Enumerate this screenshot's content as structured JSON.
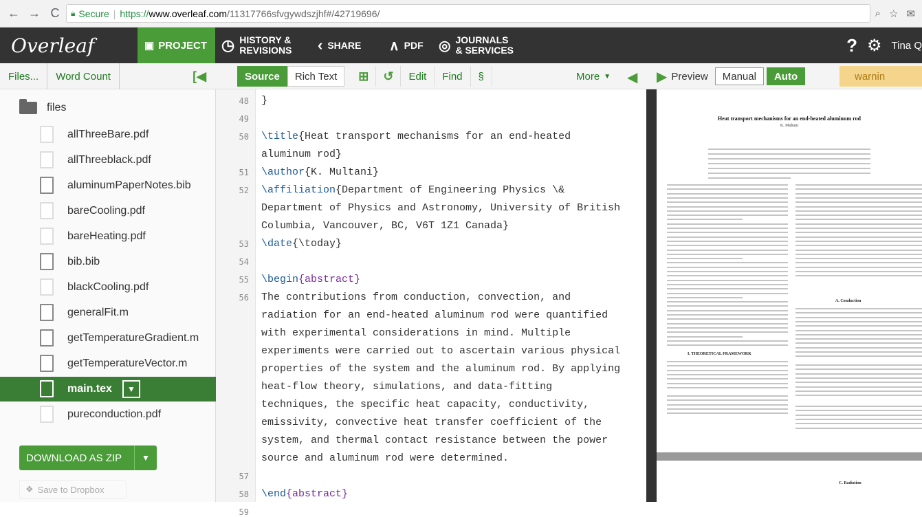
{
  "browser": {
    "back": "←",
    "forward": "→",
    "reload": "C",
    "secure_label": "Secure",
    "url_protocol": "https://",
    "url_host": "www.overleaf.com",
    "url_path": "/11317766sfvgywdszjhf#/42719696/"
  },
  "toolbar": {
    "logo": "Overleaf",
    "project": "PROJECT",
    "history_line1": "HISTORY &",
    "history_line2": "REVISIONS",
    "share": "SHARE",
    "pdf": "PDF",
    "journals_line1": "JOURNALS",
    "journals_line2": "& SERVICES",
    "help": "?",
    "user": "Tina Q"
  },
  "files_panel": {
    "files_tab": "Files...",
    "word_count_tab": "Word Count",
    "folder": "files",
    "files": [
      {
        "name": "allThreeBare.pdf",
        "type": "pdf"
      },
      {
        "name": "allThreeblack.pdf",
        "type": "pdf"
      },
      {
        "name": "aluminumPaperNotes.bib",
        "type": "doc"
      },
      {
        "name": "bareCooling.pdf",
        "type": "pdf"
      },
      {
        "name": "bareHeating.pdf",
        "type": "pdf"
      },
      {
        "name": "bib.bib",
        "type": "doc"
      },
      {
        "name": "blackCooling.pdf",
        "type": "pdf"
      },
      {
        "name": "generalFit.m",
        "type": "doc"
      },
      {
        "name": "getTemperatureGradient.m",
        "type": "doc"
      },
      {
        "name": "getTemperatureVector.m",
        "type": "doc"
      },
      {
        "name": "main.tex",
        "type": "doc",
        "selected": true
      },
      {
        "name": "pureconduction.pdf",
        "type": "pdf"
      }
    ],
    "download_zip": "DOWNLOAD AS ZIP",
    "dropbox": "Save to Dropbox"
  },
  "editor_toolbar": {
    "source": "Source",
    "rich_text": "Rich Text",
    "edit": "Edit",
    "find": "Find",
    "section": "§",
    "more": "More"
  },
  "preview": {
    "label": "Preview",
    "manual": "Manual",
    "auto": "Auto",
    "warnings": "warnin"
  },
  "editor": {
    "line_numbers": [
      "48",
      "49",
      "50",
      "51",
      "52",
      "53",
      "54",
      "55",
      "56",
      "57",
      "58",
      "59"
    ],
    "lines": [
      {
        "ln": "48",
        "text": "}"
      },
      {
        "ln": "49",
        "text": ""
      },
      {
        "ln": "50",
        "cmd": "\\title",
        "arg": "{Heat transport mechanisms for an end-heated"
      },
      {
        "ln": "",
        "text": "aluminum rod}"
      },
      {
        "ln": "51",
        "cmd": "\\author",
        "arg": "{K. Multani}"
      },
      {
        "ln": "52",
        "cmd": "\\affiliation",
        "arg": "{Department of Engineering Physics \\&"
      },
      {
        "ln": "",
        "text": "Department of Physics and Astronomy, University of British"
      },
      {
        "ln": "",
        "text": "Columbia, Vancouver, BC, V6T 1Z1 Canada}"
      },
      {
        "ln": "53",
        "cmd": "\\date",
        "arg": "{\\today}"
      },
      {
        "ln": "54",
        "text": ""
      },
      {
        "ln": "55",
        "cmd": "\\begin",
        "arg": "{abstract}"
      },
      {
        "ln": "56",
        "text": "The contributions from conduction, convection, and"
      },
      {
        "ln": "",
        "text": "radiation for an end-heated aluminum rod were quantified"
      },
      {
        "ln": "",
        "text": "with experimental considerations in mind. Multiple"
      },
      {
        "ln": "",
        "text": "experiments were carried out to ascertain various physical"
      },
      {
        "ln": "",
        "text": "properties of the system and the aluminum rod. By applying"
      },
      {
        "ln": "",
        "text": "heat-flow theory, simulations, and data-fitting"
      },
      {
        "ln": "",
        "text": "techniques, the specific heat capacity, conductivity,"
      },
      {
        "ln": "",
        "text": "emissivity, convective heat transfer coefficient of the"
      },
      {
        "ln": "",
        "text": "system, and thermal contact resistance between the power"
      },
      {
        "ln": "",
        "text": "source and aluminum rod were determined."
      },
      {
        "ln": "57",
        "text": ""
      },
      {
        "ln": "58",
        "cmd": "\\end",
        "arg": "{abstract}"
      },
      {
        "ln": "59",
        "text": ""
      }
    ]
  },
  "pdf": {
    "title": "Heat transport mechanisms for an end-heated aluminum rod",
    "author": "K. Multani",
    "section1": "I. THEORETICAL FRAMEWORK",
    "section_a": "A. Conduction",
    "section_c": "C. Radiation"
  },
  "colors": {
    "brand_green": "#4a9c38",
    "toolbar_bg": "#333333",
    "warning_bg": "#f5d58c"
  }
}
